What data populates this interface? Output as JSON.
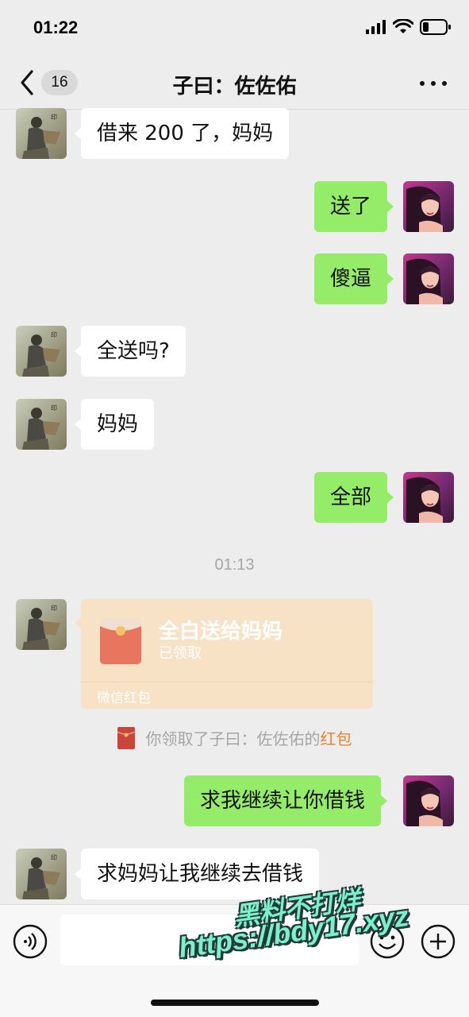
{
  "status_bar": {
    "time": "01:22",
    "icons": [
      "signal-icon",
      "wifi-icon",
      "battery-icon"
    ]
  },
  "nav": {
    "back_icon": "chevron-left-icon",
    "unread_count": "16",
    "title": "子曰：佐佐佑",
    "more_icon": "more-dots-icon"
  },
  "messages": [
    {
      "side": "left",
      "text": "借来 200 了，妈妈"
    },
    {
      "side": "right",
      "text": "送了"
    },
    {
      "side": "right",
      "text": "傻逼"
    },
    {
      "side": "left",
      "text": "全送吗?"
    },
    {
      "side": "left",
      "text": "妈妈"
    },
    {
      "side": "right",
      "text": "全部"
    },
    {
      "side": "right",
      "text": "求我继续让你借钱"
    },
    {
      "side": "left",
      "text": "求妈妈让我继续去借钱"
    }
  ],
  "time_divider": "01:13",
  "red_packet": {
    "title": "全白送给妈妈",
    "status": "已领取",
    "footer": "微信红包"
  },
  "system_note": {
    "prefix": "你领取了子曰：佐佐佑的",
    "link": "红包"
  },
  "input_bar": {
    "placeholder": "",
    "voice_icon": "voice-icon",
    "emoji_icon": "emoji-icon",
    "plus_icon": "plus-icon"
  },
  "watermark": {
    "line1": "黑料不打烊",
    "line2": "https://bdy17.xyz"
  },
  "colors": {
    "background": "#ededed",
    "bubble_self": "#95ec69",
    "bubble_other": "#ffffff",
    "red_packet": "#f8e2c5",
    "link_orange": "#e6862c"
  }
}
